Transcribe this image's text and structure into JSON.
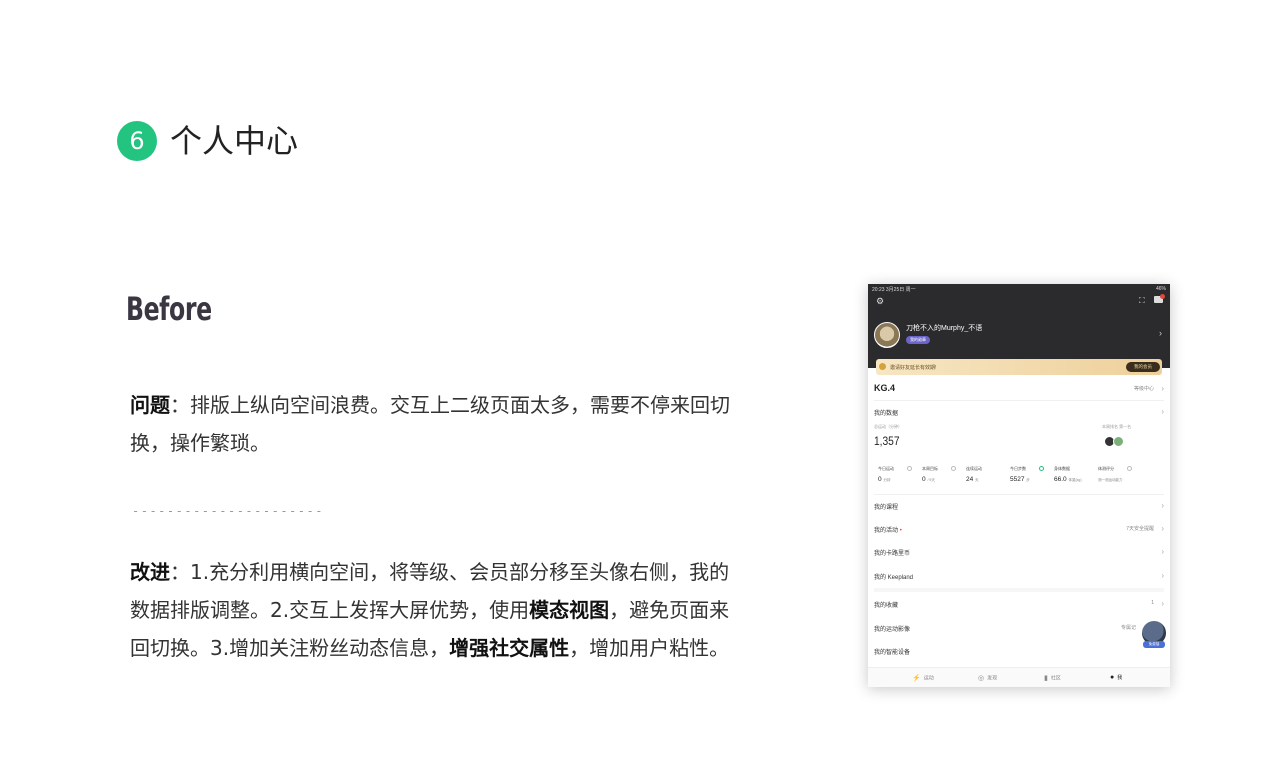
{
  "section": {
    "number": "6",
    "title": "个人中心"
  },
  "label": "Before",
  "problem": {
    "key": "问题",
    "sep": "：",
    "text": "排版上纵向空间浪费。交互上二级页面太多，需要不停来回切换，操作繁琐。"
  },
  "divider": "------------------------",
  "improve": {
    "key": "改进",
    "sep": "：",
    "t1": "1.充分利用横向空间，将等级、会员部分移至头像右侧，我的数据排版调整。2.交互上发挥大屏优势，使用",
    "b1": "模态视图",
    "t2": "，避免页面来回切换。3.增加关注粉丝动态信息，",
    "b2": "增强社交属性",
    "t3": "，增加用户粘性。"
  },
  "tablet": {
    "status_left": "20:23  3月25日 周一",
    "status_right": "46%",
    "username": "刀枪不入的Murphy_不语",
    "badge": "我的勋章",
    "vip_text": "邀请好友延长有效期!",
    "vip_button": "我的会员",
    "level": "KG.4",
    "level_right": "等级中心",
    "my_data": "我的数据",
    "total_label": "总运动（分钟）",
    "total_value": "1,357",
    "rank_label": "本周排名  第一名",
    "cards": [
      {
        "label": "今日运动",
        "value": "0",
        "unit": "分钟"
      },
      {
        "label": "本周目标",
        "value": "0",
        "unit": "/ 5天"
      },
      {
        "label": "连续运动",
        "value": "24",
        "unit": "天"
      },
      {
        "label": "今日步数",
        "value": "5527",
        "unit": "步"
      },
      {
        "label": "身体数据",
        "value": "66.0",
        "unit": "体重(kg)"
      },
      {
        "label": "体测评分",
        "value": "",
        "unit": "测一测运动能力"
      }
    ],
    "rows": [
      {
        "label": "我的课程",
        "right": ""
      },
      {
        "label": "我的活动",
        "right": "7天安全提醒"
      },
      {
        "label": "我的卡路里币",
        "right": ""
      },
      {
        "label": "我的 Keepland",
        "right": ""
      },
      {
        "label": "我的收藏",
        "right": "1"
      },
      {
        "label": "我的运动影像",
        "right": "专属记"
      },
      {
        "label": "我的智能设备",
        "right": ""
      }
    ],
    "float_tag": "免费抽",
    "tabs": [
      "运动",
      "发现",
      "社区",
      "我"
    ]
  }
}
